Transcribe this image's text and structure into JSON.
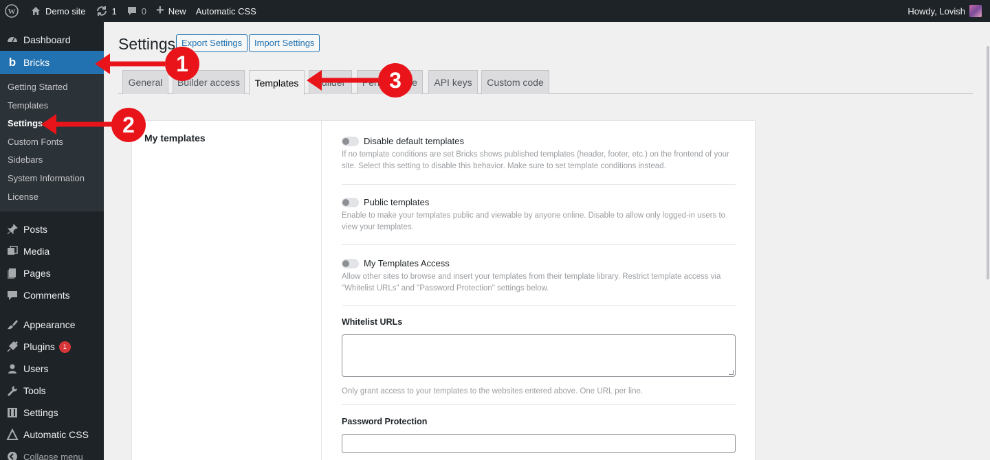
{
  "adminbar": {
    "site_name": "Demo site",
    "updates_count": "1",
    "comments_count": "0",
    "new_label": "New",
    "plugin_link": "Automatic CSS",
    "greeting": "Howdy, Lovish"
  },
  "sidebar": {
    "dashboard": "Dashboard",
    "bricks": "Bricks",
    "bricks_submenu": [
      "Getting Started",
      "Templates",
      "Settings",
      "Custom Fonts",
      "Sidebars",
      "System Information",
      "License"
    ],
    "posts": "Posts",
    "media": "Media",
    "pages": "Pages",
    "comments": "Comments",
    "appearance": "Appearance",
    "plugins": "Plugins",
    "plugins_badge": "1",
    "users": "Users",
    "tools": "Tools",
    "settings": "Settings",
    "automatic_css": "Automatic CSS",
    "collapse": "Collapse menu"
  },
  "page": {
    "title": "Settings",
    "export_button": "Export Settings",
    "import_button": "Import Settings",
    "tabs": [
      "General",
      "Builder access",
      "Templates",
      "Builder",
      "Performance",
      "API keys",
      "Custom code"
    ],
    "active_tab": "Templates"
  },
  "templates": {
    "section_title": "My templates",
    "disable_default": {
      "label": "Disable default templates",
      "desc_line1": "If no template conditions are set Bricks shows published templates (header, footer, etc.) on the frontend of your",
      "desc_line2": "site. Select this setting to disable this behavior. Make sure to set template conditions instead."
    },
    "public_templates": {
      "label": "Public templates",
      "desc_line1": "Enable to make your templates public and viewable by anyone online. Disable to allow only logged-in users to",
      "desc_line2": "view your templates."
    },
    "my_templates_access": {
      "label": "My Templates Access",
      "desc_line1": "Allow other sites to browse and insert your templates from their template library. Restrict template access via",
      "desc_line2": "\"Whitelist URLs\" and \"Password Protection\" settings below."
    },
    "whitelist": {
      "label": "Whitelist URLs",
      "value": "",
      "desc": "Only grant access to your templates to the websites entered above. One URL per line."
    },
    "password": {
      "label": "Password Protection",
      "value": ""
    }
  },
  "annotations": {
    "callout_1": "1",
    "callout_2": "2",
    "callout_3": "3",
    "arrow_color": "#e8141a"
  },
  "colors": {
    "accent": "#2271b1",
    "adminbar": "#1d2327",
    "badge": "#d63638"
  }
}
